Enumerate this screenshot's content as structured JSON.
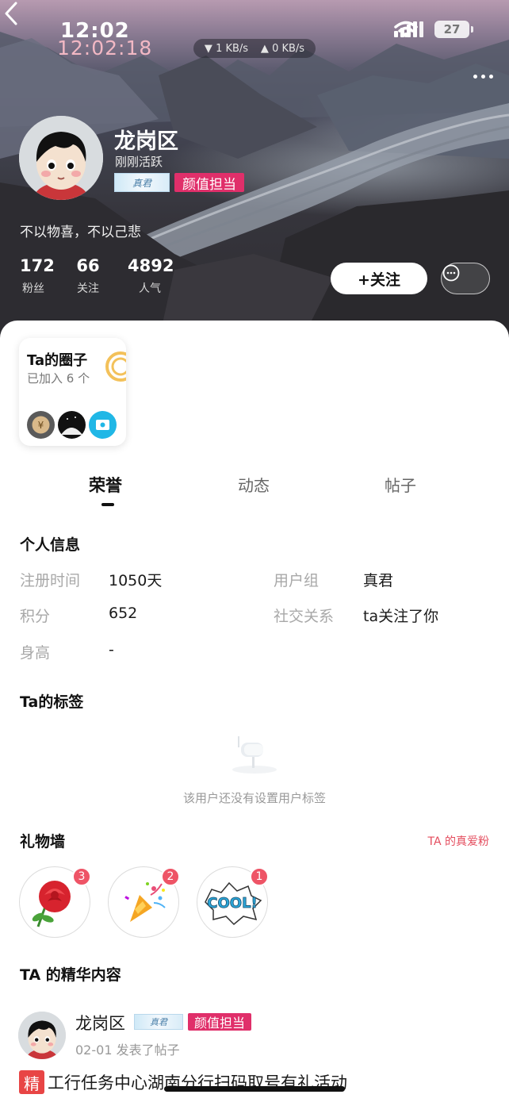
{
  "status_bar": {
    "time": "12:02",
    "time_overlay": "12:02:18",
    "download_speed": "1 KB/s",
    "upload_speed": "0 KB/s",
    "battery": "27"
  },
  "profile": {
    "name": "龙岗区",
    "status": "刚刚活跃",
    "badge_text": "真君",
    "title_badge": "颜值担当",
    "bio": "不以物喜，不以己悲",
    "stats": [
      {
        "value": "172",
        "label": "粉丝"
      },
      {
        "value": "66",
        "label": "关注"
      },
      {
        "value": "4892",
        "label": "人气"
      }
    ],
    "follow_label": "+关注"
  },
  "circle": {
    "title": "Ta的圈子",
    "subtitle": "已加入 6 个"
  },
  "tabs": [
    {
      "label": "荣誉",
      "active": true
    },
    {
      "label": "动态",
      "active": false
    },
    {
      "label": "帖子",
      "active": false
    }
  ],
  "personal_info": {
    "title": "个人信息",
    "rows": [
      {
        "k1": "注册时间",
        "v1": "1050天",
        "k2": "用户组",
        "v2": "真君"
      },
      {
        "k1": "积分",
        "v1": "652",
        "k2": "社交关系",
        "v2": "ta关注了你"
      },
      {
        "k1": "身高",
        "v1": "-",
        "k2": "",
        "v2": ""
      }
    ]
  },
  "tags": {
    "title": "Ta的标签",
    "empty_text": "该用户还没有设置用户标签"
  },
  "gifts": {
    "title": "礼物墙",
    "link": "TA 的真爱粉",
    "items": [
      {
        "icon": "rose-icon",
        "count": "3"
      },
      {
        "icon": "party-popper-icon",
        "count": "2"
      },
      {
        "icon": "cool-sticker-icon",
        "count": "1",
        "text": "COOL!"
      }
    ]
  },
  "featured": {
    "title": "TA 的精华内容",
    "post": {
      "author": "龙岗区",
      "badge_text": "真君",
      "title_badge": "颜值担当",
      "meta": "02-01 发表了帖子",
      "tag": "精",
      "title": "工行任务中心湖南分行扫码取号有礼活动"
    }
  },
  "colors": {
    "accent_pink": "#e02f6a",
    "count_red": "#ee5466",
    "link_red": "#e44d5e"
  }
}
